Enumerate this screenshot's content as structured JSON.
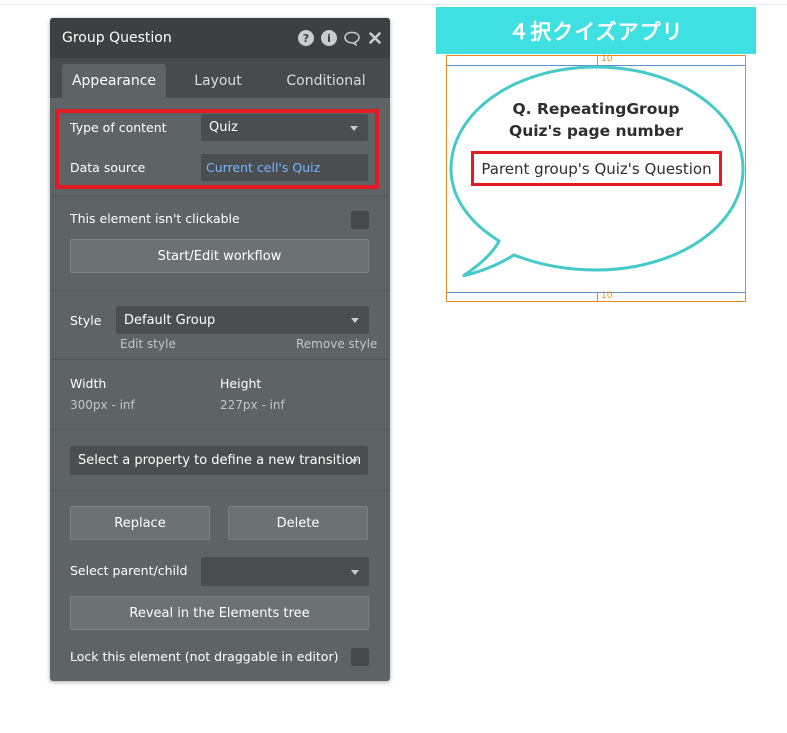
{
  "panel": {
    "title": "Group Question",
    "tabs": [
      "Appearance",
      "Layout",
      "Conditional"
    ],
    "type_of_content_label": "Type of content",
    "type_of_content_value": "Quiz",
    "data_source_label": "Data source",
    "data_source_value": "Current cell's Quiz",
    "not_clickable_label": "This element isn't clickable",
    "workflow_button": "Start/Edit workflow",
    "style_label": "Style",
    "style_value": "Default Group",
    "edit_style": "Edit style",
    "remove_style": "Remove style",
    "width_label": "Width",
    "width_value": "300px - inf",
    "height_label": "Height",
    "height_value": "227px - inf",
    "transition_placeholder": "Select a property to define a new transition",
    "replace_button": "Replace",
    "delete_button": "Delete",
    "parent_child_label": "Select parent/child",
    "reveal_button": "Reveal in the Elements tree",
    "lock_label": "Lock this element (not draggable in editor)"
  },
  "preview": {
    "banner": "４択クイズアプリ",
    "padding_top": "10",
    "padding_bottom": "10",
    "question_line1": "Q. RepeatingGroup",
    "question_line2": "Quiz's page number",
    "question_text": "Parent group's Quiz's Question"
  },
  "colors": {
    "panel_bg": "#5e6366",
    "header_bg": "#3c4043",
    "highlight_red": "#e01b22",
    "banner_cyan": "#3ee0e2",
    "link_blue": "#78b4ff"
  }
}
